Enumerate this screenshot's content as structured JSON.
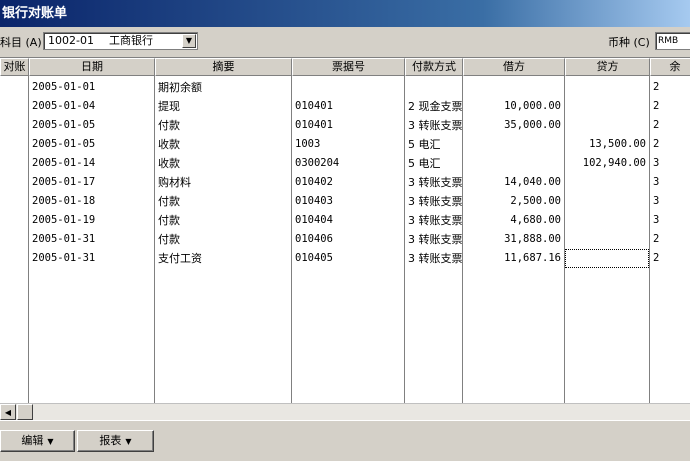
{
  "window": {
    "title": "银行对账单"
  },
  "toolbar": {
    "account_label": "科目",
    "account_hotkey": "(A)",
    "account_code": "1002-01",
    "account_name": "工商银行",
    "currency_label": "币种",
    "currency_hotkey": "(C)",
    "currency_value": "RMB"
  },
  "table": {
    "headers": [
      "对账",
      "日期",
      "摘要",
      "票据号",
      "付款方式",
      "借方",
      "贷方",
      "余"
    ],
    "rows": [
      [
        "",
        "2005-01-01",
        "期初余额",
        "",
        "",
        "",
        "",
        "2"
      ],
      [
        "",
        "2005-01-04",
        "提现",
        "010401",
        "2 现金支票",
        "10,000.00",
        "",
        "2"
      ],
      [
        "",
        "2005-01-05",
        "付款",
        "010401",
        "3 转账支票",
        "35,000.00",
        "",
        "2"
      ],
      [
        "",
        "2005-01-05",
        "收款",
        "1003",
        "5 电汇",
        "",
        "13,500.00",
        "2"
      ],
      [
        "",
        "2005-01-14",
        "收款",
        "0300204",
        "5 电汇",
        "",
        "102,940.00",
        "3"
      ],
      [
        "",
        "2005-01-17",
        "购材料",
        "010402",
        "3 转账支票",
        "14,040.00",
        "",
        "3"
      ],
      [
        "",
        "2005-01-18",
        "付款",
        "010403",
        "3 转账支票",
        "2,500.00",
        "",
        "3"
      ],
      [
        "",
        "2005-01-19",
        "付款",
        "010404",
        "3 转账支票",
        "4,680.00",
        "",
        "3"
      ],
      [
        "",
        "2005-01-31",
        "付款",
        "010406",
        "3 转账支票",
        "31,888.00",
        "",
        "2"
      ],
      [
        "",
        "2005-01-31",
        "支付工资",
        "010405",
        "3 转账支票",
        "11,687.16",
        "",
        "2"
      ]
    ]
  },
  "footer": {
    "edit_label": "编辑",
    "report_label": "报表"
  }
}
